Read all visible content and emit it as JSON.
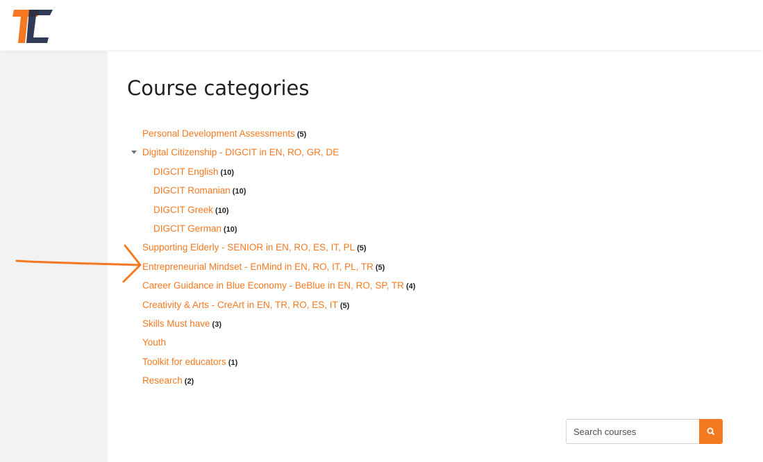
{
  "header": {
    "logo_icon": "tc-logo-icon",
    "colors": {
      "logo_orange": "#f47920",
      "logo_navy": "#1e2a4a"
    }
  },
  "main": {
    "title": "Course categories",
    "accent_color": "#f47920"
  },
  "categories": [
    {
      "label": "Personal Development Assessments",
      "count": "(5)",
      "level": 0
    },
    {
      "label": "Digital Citizenship - DIGCIT in EN, RO, GR, DE",
      "count": "",
      "level": 0,
      "expanded": true
    },
    {
      "label": "DIGCIT English",
      "count": "(10)",
      "level": 1
    },
    {
      "label": "DIGCIT Romanian",
      "count": "(10)",
      "level": 1
    },
    {
      "label": "DIGCIT Greek",
      "count": "(10)",
      "level": 1
    },
    {
      "label": "DIGCIT German",
      "count": "(10)",
      "level": 1
    },
    {
      "label": "Supporting Elderly - SENIOR in EN, RO, ES, IT, PL",
      "count": "(5)",
      "level": 0
    },
    {
      "label": "Entrepreneurial Mindset - EnMind in EN, RO, IT, PL, TR",
      "count": "(5)",
      "level": 0,
      "highlighted": true
    },
    {
      "label": "Career Guidance in Blue Economy - BeBlue in EN, RO, SP, TR",
      "count": "(4)",
      "level": 0
    },
    {
      "label": "Creativity & Arts - CreArt in EN, TR, RO, ES, IT",
      "count": "(5)",
      "level": 0
    },
    {
      "label": "Skills Must have",
      "count": "(3)",
      "level": 0
    },
    {
      "label": "Youth",
      "count": "",
      "level": 0
    },
    {
      "label": "Toolkit for educators",
      "count": "(1)",
      "level": 0
    },
    {
      "label": "Research",
      "count": "(2)",
      "level": 0
    }
  ],
  "search": {
    "placeholder": "Search courses",
    "button_icon": "search-icon"
  },
  "annotation": {
    "icon": "hand-drawn-arrow-icon",
    "color": "#f47920"
  }
}
